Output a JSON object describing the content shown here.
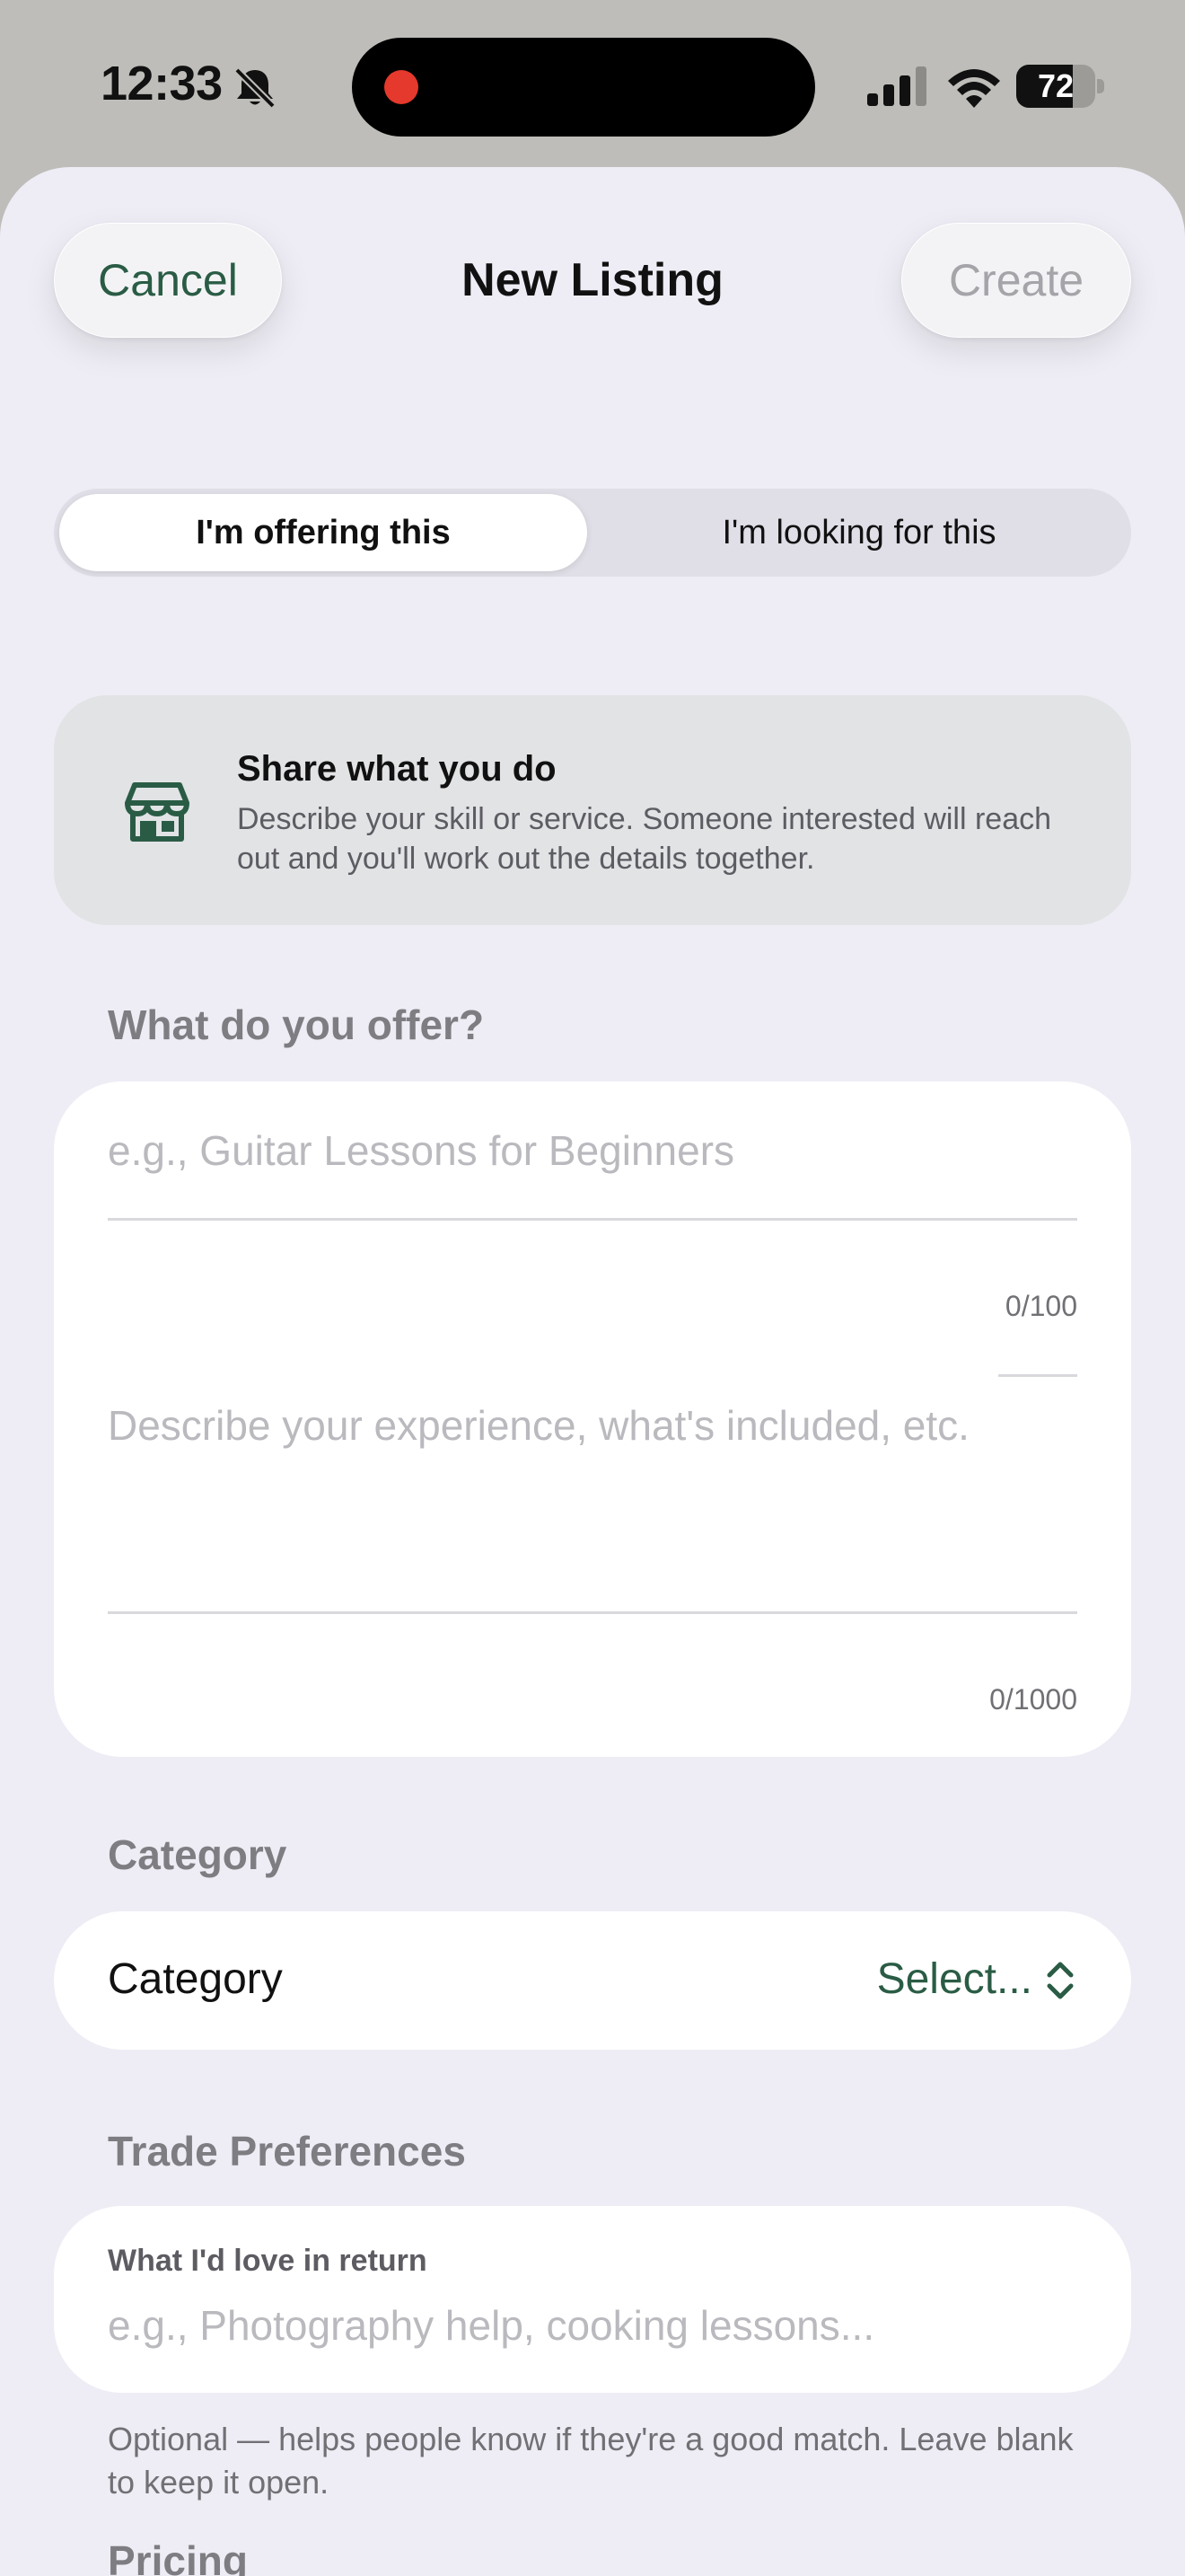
{
  "status_bar": {
    "time": "12:33",
    "battery_level": "72",
    "icons": [
      "bell-slash-icon",
      "cellular-signal-icon",
      "wifi-icon",
      "battery-icon"
    ]
  },
  "header": {
    "cancel_label": "Cancel",
    "title": "New Listing",
    "create_label": "Create"
  },
  "segmented": {
    "options": [
      "I'm offering this",
      "I'm looking for this"
    ],
    "selected": "I'm offering this"
  },
  "info_card": {
    "icon": "storefront-icon",
    "title": "Share what you do",
    "description": "Describe your skill or service. Someone interested will reach out and you'll work out the details together."
  },
  "offer_section": {
    "label": "What do you offer?",
    "title_field": {
      "value": "",
      "placeholder": "e.g., Guitar Lessons for Beginners",
      "counter": "0/100"
    },
    "description_field": {
      "value": "",
      "placeholder": "Describe your experience, what's included, etc.",
      "counter": "0/1000"
    }
  },
  "category_section": {
    "label": "Category",
    "row_label": "Category",
    "value": "Select..."
  },
  "trade_section": {
    "label": "Trade Preferences",
    "field_label": "What I'd love in return",
    "placeholder": "e.g., Photography help, cooking lessons...",
    "helper": "Optional — helps people know if they're a good match. Leave blank to keep it open."
  },
  "pricing_section": {
    "label": "Pricing"
  },
  "colors": {
    "accent": "#2a5c45",
    "sheet_background": "#eeedf5",
    "info_card_background": "#e1e3e5",
    "recording_dot": "#e4392c"
  }
}
